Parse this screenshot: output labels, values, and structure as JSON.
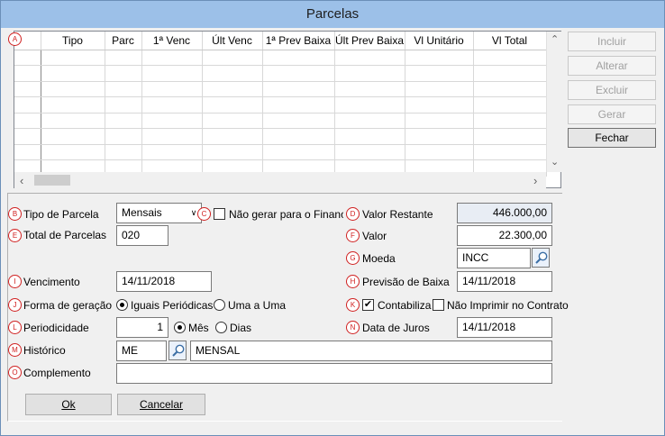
{
  "window": {
    "title": "Parcelas"
  },
  "badges": {
    "a": "A",
    "b": "B",
    "c": "C",
    "d": "D",
    "e": "E",
    "f": "F",
    "g": "G",
    "h": "H",
    "i": "I",
    "j": "J",
    "k": "K",
    "l": "L",
    "m": "M",
    "n": "N",
    "o": "O"
  },
  "grid": {
    "columns": [
      "Tipo",
      "Parc",
      "1ª Venc",
      "Últ Venc",
      "1ª Prev Baixa",
      "Últ Prev Baixa",
      "Vl Unitário",
      "Vl Total"
    ],
    "row_count": 8
  },
  "side_buttons": {
    "incluir": "Incluir",
    "alterar": "Alterar",
    "excluir": "Excluir",
    "gerar": "Gerar",
    "fechar": "Fechar"
  },
  "form": {
    "tipo_parcela": {
      "label": "Tipo de Parcela",
      "value": "Mensais"
    },
    "nao_gerar": {
      "label": "Não gerar para o Financeiro",
      "checked": false
    },
    "valor_restante": {
      "label": "Valor Restante",
      "value": "446.000,00"
    },
    "total_parcelas": {
      "label": "Total de Parcelas",
      "value": "020"
    },
    "valor": {
      "label": "Valor",
      "value": "22.300,00"
    },
    "moeda": {
      "label": "Moeda",
      "value": "INCC"
    },
    "vencimento": {
      "label": "Vencimento",
      "value": "14/11/2018"
    },
    "previsao_baixa": {
      "label": "Previsão de Baixa",
      "value": "14/11/2018"
    },
    "forma_geracao": {
      "label": "Forma de geração",
      "opt1": "Iguais Periódicas",
      "opt2": "Uma a Uma",
      "selected": "Iguais Periódicas"
    },
    "contabiliza": {
      "label": "Contabiliza",
      "checked": true
    },
    "nao_imprimir": {
      "label": "Não Imprimir no Contrato",
      "checked": false
    },
    "periodicidade": {
      "label": "Periodicidade",
      "value": "1",
      "opt1": "Mês",
      "opt2": "Dias",
      "selected": "Mês"
    },
    "data_juros": {
      "label": "Data de Juros",
      "value": "14/11/2018"
    },
    "historico": {
      "label": "Histórico",
      "code": "ME",
      "description": "MENSAL"
    },
    "complemento": {
      "label": "Complemento",
      "value": ""
    }
  },
  "buttons": {
    "ok": "Ok",
    "cancelar": "Cancelar"
  },
  "icons": {
    "lookup": "magnifier-icon",
    "dropdown": "chevron-down-icon"
  }
}
